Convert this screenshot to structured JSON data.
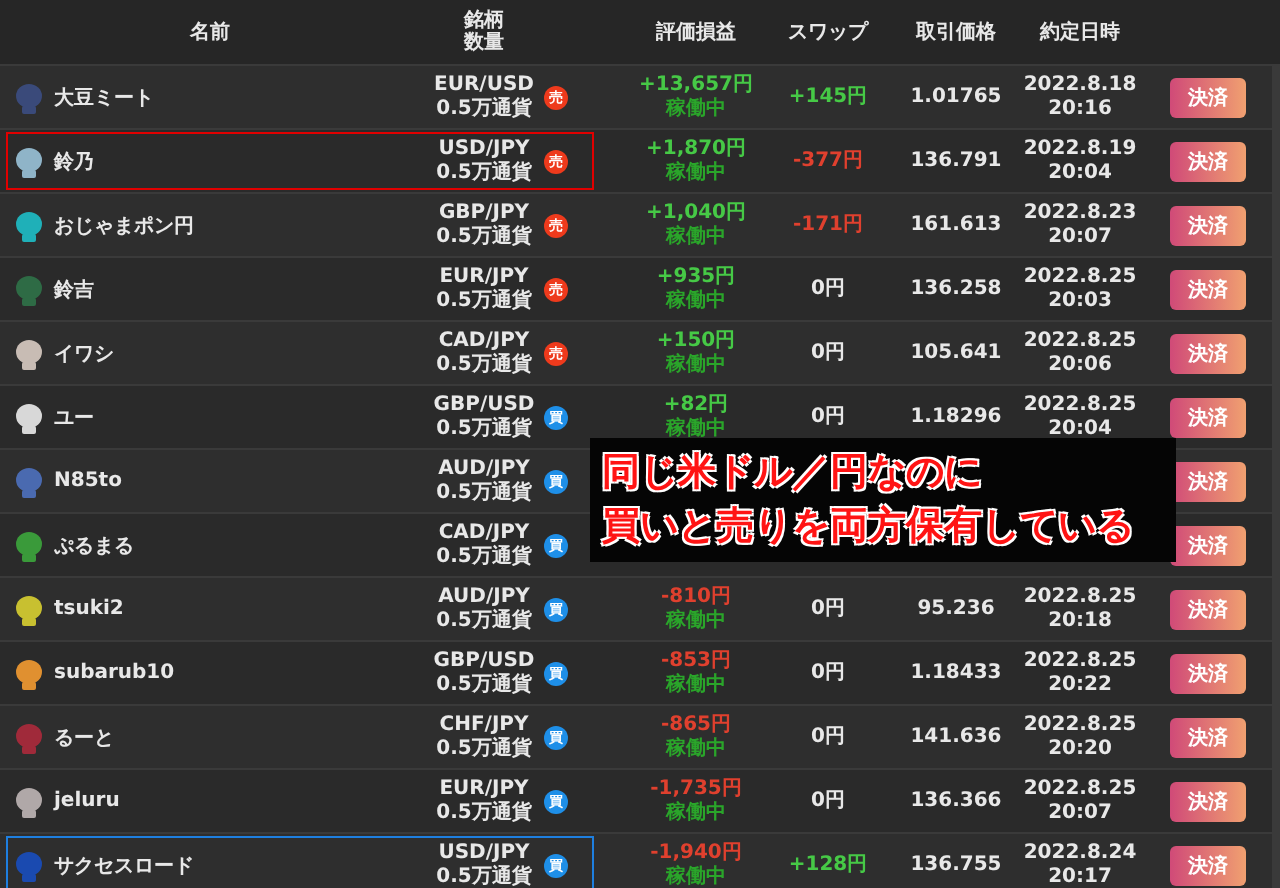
{
  "header": {
    "name": "名前",
    "pair_lines": [
      "銘柄",
      "数量"
    ],
    "pl": "評価損益",
    "swap": "スワップ",
    "price": "取引価格",
    "date": "約定日時"
  },
  "rows": [
    {
      "name": "大豆ミート",
      "color": "#3a4a7a",
      "pair": "EUR/USD",
      "amount": "0.5万通貨",
      "side": {
        "label": "売",
        "kind": "sell"
      },
      "pl": {
        "value": "+13,657円",
        "kind": "gain",
        "status": "稼働中"
      },
      "swap": {
        "value": "+145円",
        "kind": "gain"
      },
      "price": "1.01765",
      "date": "2022.8.18",
      "time": "20:16",
      "button": "決済"
    },
    {
      "name": "鈴乃",
      "color": "#8fb4c8",
      "pair": "USD/JPY",
      "amount": "0.5万通貨",
      "side": {
        "label": "売",
        "kind": "sell"
      },
      "pl": {
        "value": "+1,870円",
        "kind": "gain",
        "status": "稼働中"
      },
      "swap": {
        "value": "-377円",
        "kind": "loss"
      },
      "price": "136.791",
      "date": "2022.8.19",
      "time": "20:04",
      "button": "決済",
      "frame": {
        "color": "#e00000"
      }
    },
    {
      "name": "おじゃまポン円",
      "color": "#1fb0b8",
      "pair": "GBP/JPY",
      "amount": "0.5万通貨",
      "side": {
        "label": "売",
        "kind": "sell"
      },
      "pl": {
        "value": "+1,040円",
        "kind": "gain",
        "status": "稼働中"
      },
      "swap": {
        "value": "-171円",
        "kind": "loss"
      },
      "price": "161.613",
      "date": "2022.8.23",
      "time": "20:07",
      "button": "決済"
    },
    {
      "name": "鈴吉",
      "color": "#2e6b45",
      "pair": "EUR/JPY",
      "amount": "0.5万通貨",
      "side": {
        "label": "売",
        "kind": "sell"
      },
      "pl": {
        "value": "+935円",
        "kind": "gain",
        "status": "稼働中"
      },
      "swap": {
        "value": "0円",
        "kind": "none"
      },
      "price": "136.258",
      "date": "2022.8.25",
      "time": "20:03",
      "button": "決済"
    },
    {
      "name": "イワシ",
      "color": "#c8bcb4",
      "pair": "CAD/JPY",
      "amount": "0.5万通貨",
      "side": {
        "label": "売",
        "kind": "sell"
      },
      "pl": {
        "value": "+150円",
        "kind": "gain",
        "status": "稼働中"
      },
      "swap": {
        "value": "0円",
        "kind": "none"
      },
      "price": "105.641",
      "date": "2022.8.25",
      "time": "20:06",
      "button": "決済"
    },
    {
      "name": "ユー",
      "color": "#d8d8d8",
      "pair": "GBP/USD",
      "amount": "0.5万通貨",
      "side": {
        "label": "買",
        "kind": "buy"
      },
      "pl": {
        "value": "+82円",
        "kind": "gain",
        "status": "稼働中"
      },
      "swap": {
        "value": "0円",
        "kind": "none"
      },
      "price": "1.18296",
      "date": "2022.8.25",
      "time": "20:04",
      "button": "決済"
    },
    {
      "name": "N85to",
      "color": "#4a6ab0",
      "pair": "AUD/JPY",
      "amount": "0.5万通貨",
      "side": {
        "label": "買",
        "kind": "buy"
      },
      "button": "決済"
    },
    {
      "name": "ぷるまる",
      "color": "#3a9a3a",
      "pair": "CAD/JPY",
      "amount": "0.5万通貨",
      "side": {
        "label": "買",
        "kind": "buy"
      },
      "button": "決済"
    },
    {
      "name": "tsuki2",
      "color": "#c8c030",
      "pair": "AUD/JPY",
      "amount": "0.5万通貨",
      "side": {
        "label": "買",
        "kind": "buy"
      },
      "pl": {
        "value": "-810円",
        "kind": "loss",
        "status": "稼働中"
      },
      "swap": {
        "value": "0円",
        "kind": "none"
      },
      "price": "95.236",
      "date": "2022.8.25",
      "time": "20:18",
      "button": "決済"
    },
    {
      "name": "subarub10",
      "color": "#e09030",
      "pair": "GBP/USD",
      "amount": "0.5万通貨",
      "side": {
        "label": "買",
        "kind": "buy"
      },
      "pl": {
        "value": "-853円",
        "kind": "loss",
        "status": "稼働中"
      },
      "swap": {
        "value": "0円",
        "kind": "none"
      },
      "price": "1.18433",
      "date": "2022.8.25",
      "time": "20:22",
      "button": "決済"
    },
    {
      "name": "るーと",
      "color": "#a02a3a",
      "pair": "CHF/JPY",
      "amount": "0.5万通貨",
      "side": {
        "label": "買",
        "kind": "buy"
      },
      "pl": {
        "value": "-865円",
        "kind": "loss",
        "status": "稼働中"
      },
      "swap": {
        "value": "0円",
        "kind": "none"
      },
      "price": "141.636",
      "date": "2022.8.25",
      "time": "20:20",
      "button": "決済"
    },
    {
      "name": "jeluru",
      "color": "#b0a8a8",
      "pair": "EUR/JPY",
      "amount": "0.5万通貨",
      "side": {
        "label": "買",
        "kind": "buy"
      },
      "pl": {
        "value": "-1,735円",
        "kind": "loss",
        "status": "稼働中"
      },
      "swap": {
        "value": "0円",
        "kind": "none"
      },
      "price": "136.366",
      "date": "2022.8.25",
      "time": "20:07",
      "button": "決済"
    },
    {
      "name": "サクセスロード",
      "color": "#1a4ab0",
      "pair": "USD/JPY",
      "amount": "0.5万通貨",
      "side": {
        "label": "買",
        "kind": "buy"
      },
      "pl": {
        "value": "-1,940円",
        "kind": "loss",
        "status": "稼働中"
      },
      "swap": {
        "value": "+128円",
        "kind": "gain"
      },
      "price": "136.755",
      "date": "2022.8.24",
      "time": "20:17",
      "button": "決済",
      "frame": {
        "color": "#1e7fe0"
      }
    }
  ],
  "callout": [
    "同じ米ドル／円なのに",
    "買いと売りを両方保有している"
  ]
}
